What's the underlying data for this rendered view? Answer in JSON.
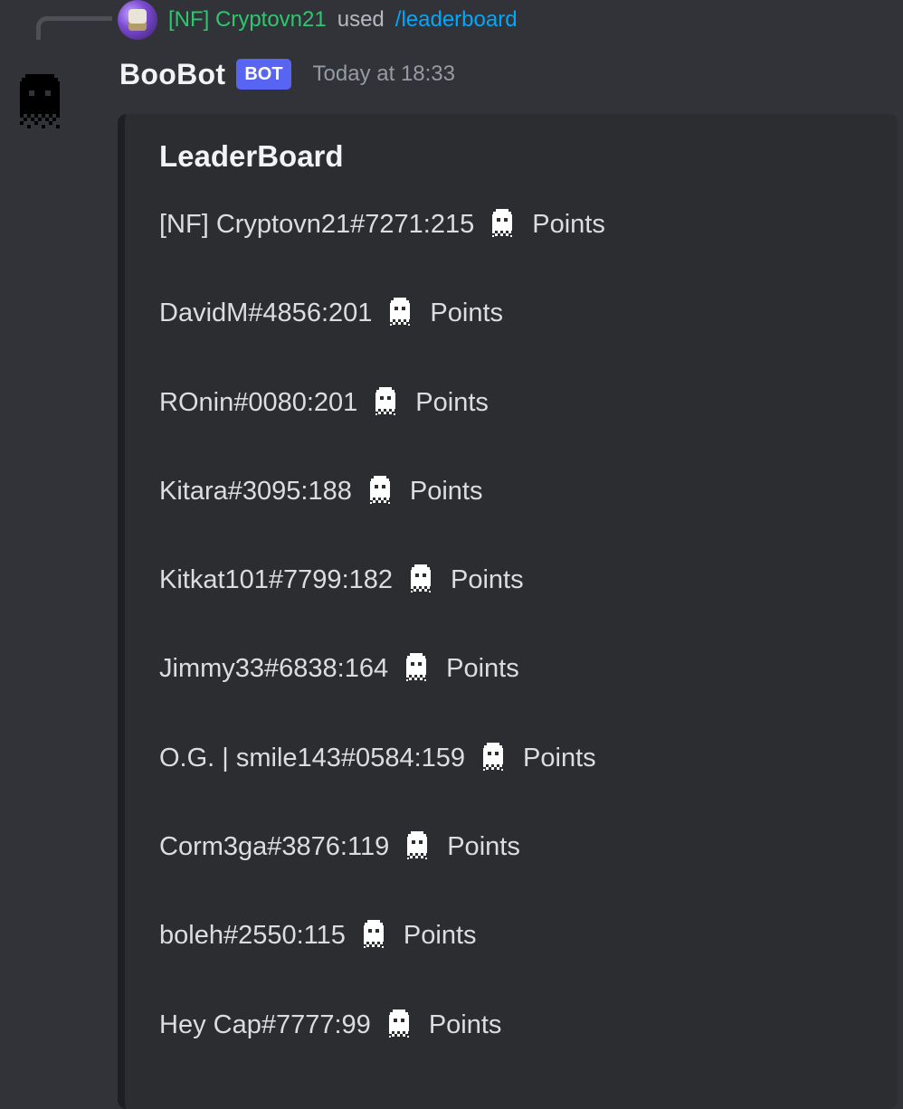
{
  "reply": {
    "user": "[NF] Cryptovn21",
    "used": "used",
    "command": "/leaderboard"
  },
  "message": {
    "author": "BooBot",
    "tag": "BOT",
    "timestamp": "Today at 18:33"
  },
  "embed": {
    "title": "LeaderBoard",
    "points_label": "Points",
    "entries": [
      {
        "name": "[NF] Cryptovn21#7271",
        "score": "215"
      },
      {
        "name": "DavidM#4856",
        "score": "201"
      },
      {
        "name": "ROnin#0080",
        "score": "201"
      },
      {
        "name": "Kitara#3095",
        "score": "188"
      },
      {
        "name": "Kitkat101#7799",
        "score": "182"
      },
      {
        "name": "Jimmy33#6838",
        "score": "164"
      },
      {
        "name": "O.G. | smile143#0584",
        "score": "159"
      },
      {
        "name": "Corm3ga#3876",
        "score": "119"
      },
      {
        "name": "boleh#2550",
        "score": "115"
      },
      {
        "name": "Hey Cap#7777",
        "score": "99"
      }
    ]
  },
  "icons": {
    "entry_icon": "ghost-icon",
    "bot_avatar": "pixel-ghost-avatar"
  },
  "colors": {
    "background": "#313338",
    "embed_background": "#2b2d31",
    "username_green": "#2dc770",
    "command_blue": "#00a8fc",
    "bot_tag": "#5865f2"
  }
}
